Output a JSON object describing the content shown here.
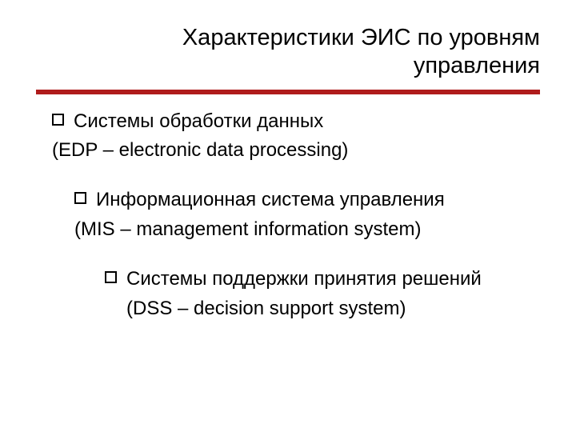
{
  "title": {
    "line1": "Характеристики ЭИС по уровням",
    "line2": "управления"
  },
  "items": [
    {
      "main": "Системы обработки данных",
      "sub": "(EDP – electronic data processing)"
    },
    {
      "main": "Информационная система управления",
      "sub": "(MIS – management information system)"
    },
    {
      "main": "Системы поддержки принятия решений",
      "sub": "(DSS – decision support system)"
    }
  ]
}
